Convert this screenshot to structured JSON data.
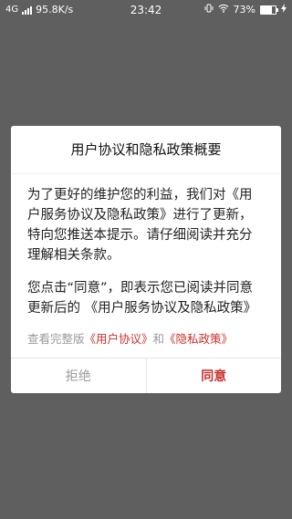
{
  "status_bar": {
    "network": "4G",
    "speed": "95.8K/s",
    "time": "23:42",
    "battery_percent": "73%",
    "battery_level": 0.73
  },
  "dialog": {
    "title": "用户协议和隐私政策概要",
    "paragraph1": "为了更好的维护您的利益，我们对《用户服务协议及隐私政策》进行了更新，特向您推送本提示。请仔细阅读并充分理解相关条款。",
    "paragraph2": "您点击“同意”，即表示您已阅读并同意更新后的 《用户服务协议及隐私政策》",
    "links_prefix": "查看完整版",
    "link_user_agreement": "《用户协议》",
    "links_and": "和",
    "link_privacy_policy": "《隐私政策》",
    "reject_label": "拒绝",
    "agree_label": "同意"
  },
  "colors": {
    "accent": "#c9302c",
    "overlay": "#5f5f5f"
  }
}
